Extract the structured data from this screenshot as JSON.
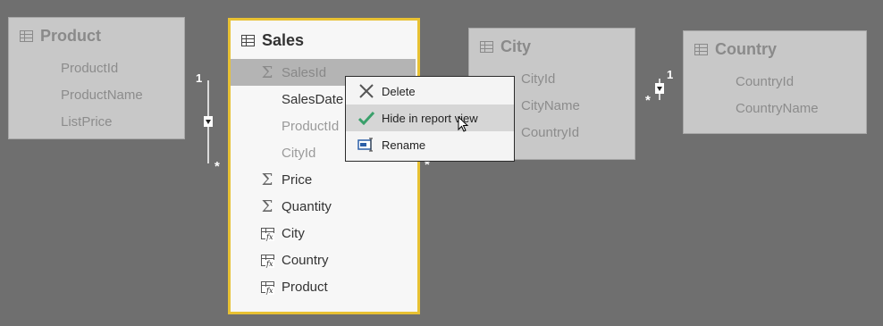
{
  "tables": {
    "product": {
      "title": "Product",
      "icon": "table-icon",
      "fields": [
        "ProductId",
        "ProductName",
        "ListPrice"
      ]
    },
    "sales": {
      "title": "Sales",
      "icon": "table-icon",
      "selected": true,
      "fields": [
        {
          "label": "SalesId",
          "icon": "sigma-icon",
          "hidden": true,
          "highlighted": true
        },
        {
          "label": "SalesDate",
          "icon": "",
          "hidden": false
        },
        {
          "label": "ProductId",
          "icon": "",
          "hidden": true
        },
        {
          "label": "CityId",
          "icon": "",
          "hidden": true
        },
        {
          "label": "Price",
          "icon": "sigma-icon",
          "hidden": false
        },
        {
          "label": "Quantity",
          "icon": "sigma-icon",
          "hidden": false
        },
        {
          "label": "City",
          "icon": "calculated-column-icon",
          "hidden": false
        },
        {
          "label": "Country",
          "icon": "calculated-column-icon",
          "hidden": false
        },
        {
          "label": "Product",
          "icon": "calculated-column-icon",
          "hidden": false
        }
      ]
    },
    "city": {
      "title": "City",
      "icon": "table-icon",
      "fields": [
        "CityId",
        "CityName",
        "CountryId"
      ]
    },
    "country": {
      "title": "Country",
      "icon": "table-icon",
      "fields": [
        "CountryId",
        "CountryName"
      ]
    }
  },
  "relationships": {
    "product_sales": {
      "one": "1",
      "many": "*"
    },
    "sales_city": {
      "many": "*"
    },
    "city_country": {
      "one": "1",
      "many": "*"
    }
  },
  "context_menu": {
    "items": [
      {
        "label": "Delete",
        "icon": "x-delete-icon",
        "highlighted": false
      },
      {
        "label": "Hide in report view",
        "icon": "checkmark-icon",
        "highlighted": true
      },
      {
        "label": "Rename",
        "icon": "rename-icon",
        "highlighted": false
      }
    ]
  },
  "colors": {
    "canvas": "#6f6f6f",
    "selected_border": "#e8c133",
    "check_green": "#3aa06b"
  }
}
